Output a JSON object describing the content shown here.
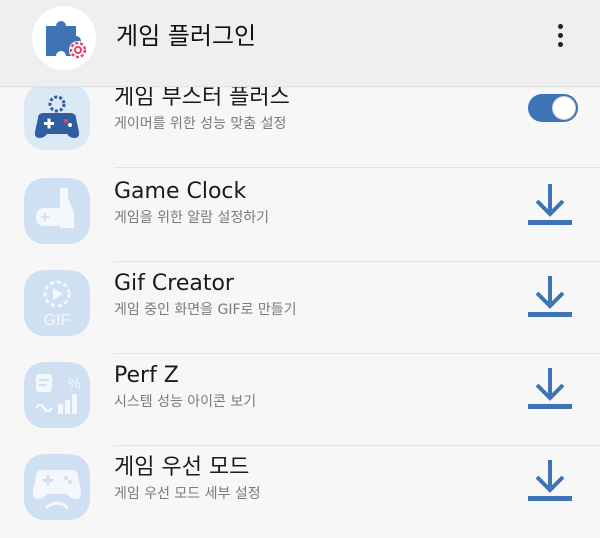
{
  "colors": {
    "accent": "#3e73b6",
    "icon_bg": "#cfe0f2",
    "icon_bg_active": "#dbe8f5",
    "icon_fg": "#f4f8fc",
    "divider": "#e4e4e4"
  },
  "header": {
    "title": "게임 플러그인",
    "logo_icon": "puzzle-gear-icon",
    "menu_icon": "more-vert-icon"
  },
  "plugins": [
    {
      "title": "게임 부스터 플러스",
      "subtitle": "게이머를 위한 성능 맞춤 설정",
      "icon": "game-booster-icon",
      "action": "toggle",
      "enabled": true
    },
    {
      "title": "Game Clock",
      "subtitle": "게임을 위한 알람 설정하기",
      "icon": "game-clock-icon",
      "action": "download"
    },
    {
      "title": "Gif Creator",
      "subtitle": "게임 중인 화면을 GIF로 만들기",
      "icon": "gif-creator-icon",
      "icon_text": "GIF",
      "action": "download"
    },
    {
      "title": "Perf Z",
      "subtitle": "시스템 성능 아이콘 보기",
      "icon": "perf-z-icon",
      "action": "download"
    },
    {
      "title": "게임 우선 모드",
      "subtitle": "게임 우선 모드 세부 설정",
      "icon": "game-priority-mode-icon",
      "action": "download"
    }
  ]
}
